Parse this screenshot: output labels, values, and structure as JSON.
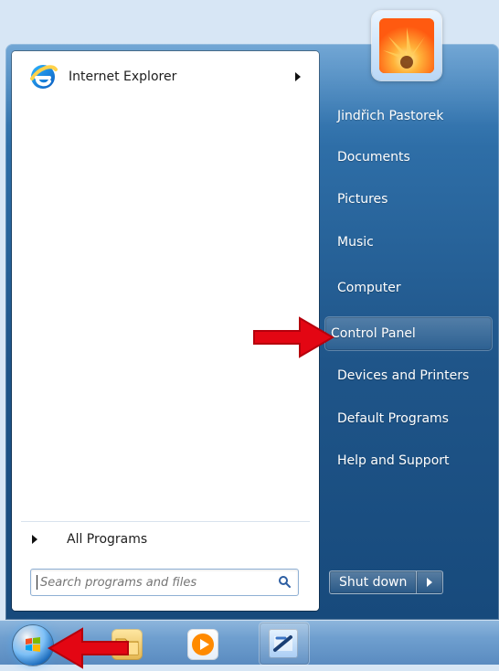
{
  "startmenu": {
    "left_pane": {
      "pinned": [
        {
          "label": "Internet Explorer",
          "icon": "internet-explorer-icon",
          "has_submenu": true
        }
      ],
      "all_programs_label": "All Programs",
      "search": {
        "placeholder": "Search programs and files",
        "value": ""
      }
    },
    "right_pane": {
      "user_name": "Jindřich Pastorek",
      "items": [
        {
          "label": "Documents"
        },
        {
          "label": "Pictures"
        },
        {
          "label": "Music"
        },
        {
          "label": "Computer"
        },
        {
          "label": "Control Panel",
          "highlighted": true
        },
        {
          "label": "Devices and Printers"
        },
        {
          "label": "Default Programs"
        },
        {
          "label": "Help and Support"
        }
      ],
      "shutdown_label": "Shut down"
    }
  },
  "taskbar": {
    "items": [
      {
        "name": "start-orb"
      },
      {
        "name": "windows-explorer"
      },
      {
        "name": "windows-media-player"
      },
      {
        "name": "pinned-app"
      }
    ]
  },
  "annotations": {
    "arrow_color": "#e30613"
  }
}
